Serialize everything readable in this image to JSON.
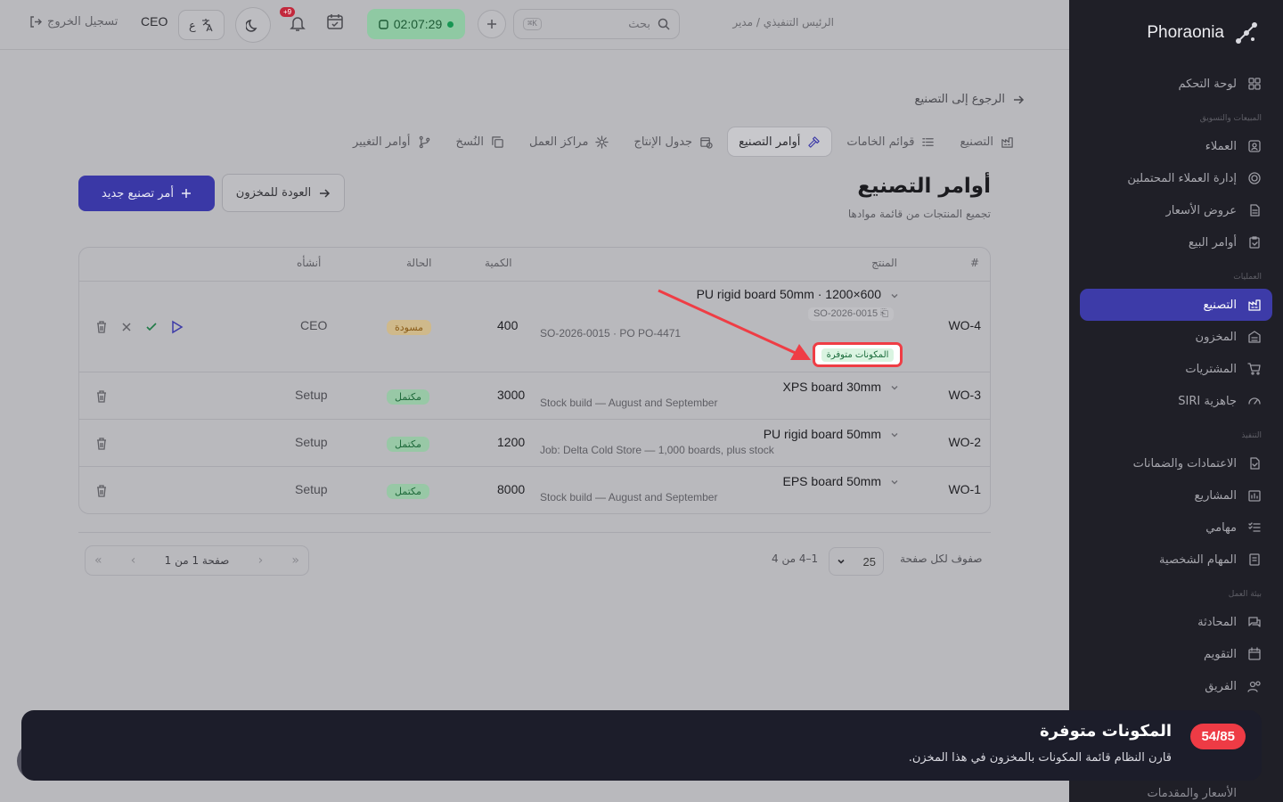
{
  "sidebar": {
    "brand": "Phoraonia",
    "items": [
      {
        "label": "لوحة التحكم",
        "icon": "dashboard-icon"
      },
      {
        "section": "المبيعات والتسويق"
      },
      {
        "label": "العملاء",
        "icon": "contacts-icon"
      },
      {
        "label": "إدارة العملاء المحتملين",
        "icon": "target-icon"
      },
      {
        "label": "عروض الأسعار",
        "icon": "document-icon"
      },
      {
        "label": "أوامر البيع",
        "icon": "clipboard-icon"
      },
      {
        "section": "العمليات"
      },
      {
        "label": "التصنيع",
        "icon": "factory-icon",
        "active": true
      },
      {
        "label": "المخزون",
        "icon": "warehouse-icon"
      },
      {
        "label": "المشتريات",
        "icon": "cart-icon"
      },
      {
        "label": "جاهزية SIRI",
        "icon": "gauge-icon"
      },
      {
        "section": "التنفيذ"
      },
      {
        "label": "الاعتمادات والضمانات",
        "icon": "file-check-icon"
      },
      {
        "label": "المشاريع",
        "icon": "projects-icon"
      },
      {
        "label": "مهامي",
        "icon": "tasks-icon"
      },
      {
        "label": "المهام الشخصية",
        "icon": "personal-tasks-icon"
      },
      {
        "section": "بيئة العمل"
      },
      {
        "label": "المحادثة",
        "icon": "chat-icon"
      },
      {
        "label": "التقويم",
        "icon": "calendar-icon"
      },
      {
        "label": "الفريق",
        "icon": "team-icon"
      }
    ],
    "bottom_item": "الأسعار والمقدمات"
  },
  "topbar": {
    "breadcrumb": "الرئيس التنفيذي / مدير",
    "search_placeholder": "بحث",
    "search_shortcut": "K⌘",
    "timer": "02:07:29",
    "notification_count": "+9",
    "user": "CEO",
    "logout": "تسجيل الخروج"
  },
  "page": {
    "back_link": "الرجوع إلى التصنيع",
    "tabs": [
      {
        "label": "التصنيع",
        "icon": "factory-icon"
      },
      {
        "label": "قوائم الخامات",
        "icon": "list-icon"
      },
      {
        "label": "أوامر التصنيع",
        "icon": "hammer-icon",
        "active": true
      },
      {
        "label": "جدول الإنتاج",
        "icon": "calendar-clock-icon"
      },
      {
        "label": "مراكز العمل",
        "icon": "cog-icon"
      },
      {
        "label": "النُسخ",
        "icon": "copy-icon"
      },
      {
        "label": "أوامر التغيير",
        "icon": "branch-icon"
      }
    ],
    "title": "أوامر التصنيع",
    "subtitle": "تجميع المنتجات من قائمة موادها",
    "new_order_button": "أمر تصنيع جديد",
    "back_to_inventory_button": "العودة للمخزون"
  },
  "table": {
    "headers": {
      "id": "#",
      "product": "المنتج",
      "quantity": "الكمية",
      "status": "الحالة",
      "creator": "أنشأه"
    },
    "rows": [
      {
        "id": "WO-4",
        "product": "PU rigid board 50mm · 1200×600",
        "so_tag": "SO-2026-0015",
        "desc": "SO-2026-0015 · PO PO-4471",
        "availability": "المكونات متوفرة",
        "quantity": "400",
        "status": "مسودة",
        "status_type": "draft",
        "creator": "CEO"
      },
      {
        "id": "WO-3",
        "product": "XPS board 30mm",
        "desc": "Stock build — August and September",
        "quantity": "3000",
        "status": "مكتمل",
        "status_type": "done",
        "creator": "Setup"
      },
      {
        "id": "WO-2",
        "product": "PU rigid board 50mm",
        "desc": "Job: Delta Cold Store — 1,000 boards, plus stock",
        "quantity": "1200",
        "status": "مكتمل",
        "status_type": "done",
        "creator": "Setup"
      },
      {
        "id": "WO-1",
        "product": "EPS board 50mm",
        "desc": "Stock build — August and September",
        "quantity": "8000",
        "status": "مكتمل",
        "status_type": "done",
        "creator": "Setup"
      }
    ]
  },
  "pagination": {
    "rows_per_page_label": "صفوف لكل صفحة",
    "rows_per_page_value": "25",
    "range": "1–4 من 4",
    "page_label": "صفحة 1 من 1"
  },
  "tour": {
    "step": "54/85",
    "title": "المكونات متوفرة",
    "text": "قارن النظام قائمة المكونات بالمخزون في هذا المخزن."
  },
  "colors": {
    "accent": "#3d3ba8",
    "tour_badge": "#ee3b45",
    "highlight_border": "#ef3d45"
  }
}
